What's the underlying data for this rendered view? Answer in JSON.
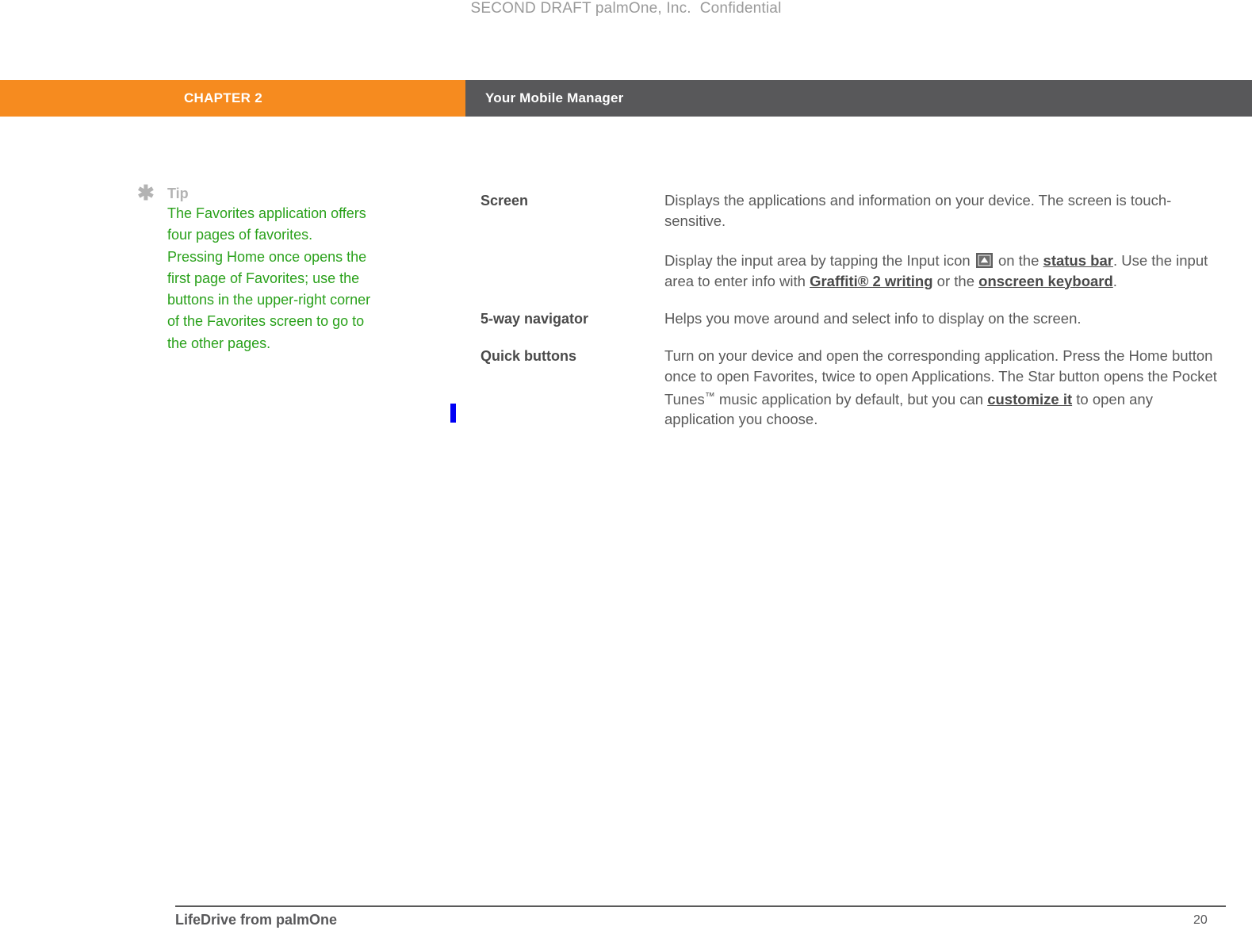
{
  "document": {
    "draft_notice": "SECOND DRAFT palmOne, Inc.  Confidential"
  },
  "header": {
    "chapter_label": "CHAPTER 2",
    "section_title": "Your Mobile Manager",
    "chapter_bg": "#f68b1f",
    "section_bg": "#58585a"
  },
  "tip": {
    "icon": "asterisk-icon",
    "asterisk": "✱",
    "label": "Tip",
    "body": "The Favorites application offers four pages of favorites. Pressing Home once opens the first page of Favorites; use the buttons in the upper-right corner of the Favorites screen to go to the other pages.",
    "text_color": "#2aa11b",
    "label_color": "#b3b3b3"
  },
  "caret": {
    "color": "#0000f5"
  },
  "definitions": [
    {
      "term": "Screen",
      "paragraph_1_a": "Displays the applications and information on your device. The screen is touch-sensitive.",
      "paragraph_2_a": "Display the input area by tapping the Input icon ",
      "paragraph_2_icon": "input-area-icon",
      "paragraph_2_b": " on the ",
      "paragraph_2_link_1": "status bar",
      "paragraph_2_c": ". Use the input area to enter info with ",
      "paragraph_2_link_2": "Graffiti® 2 writing",
      "paragraph_2_d": " or the ",
      "paragraph_2_link_3": "onscreen keyboard",
      "paragraph_2_e": "."
    },
    {
      "term": "5-way navigator",
      "paragraph_1_a": "Helps you move around and select info to display on the screen."
    },
    {
      "term": "Quick buttons",
      "paragraph_1_a": "Turn on your device and open the corresponding application. Press the Home button once to open Favorites, twice to open Applications. The Star button opens the Pocket Tunes",
      "paragraph_1_tm": "™",
      "paragraph_1_b": " music application by default, but you can ",
      "paragraph_1_link": "customize it",
      "paragraph_1_c": " to open any application you choose."
    }
  ],
  "footer": {
    "product": "LifeDrive from palmOne",
    "page_number": "20"
  }
}
